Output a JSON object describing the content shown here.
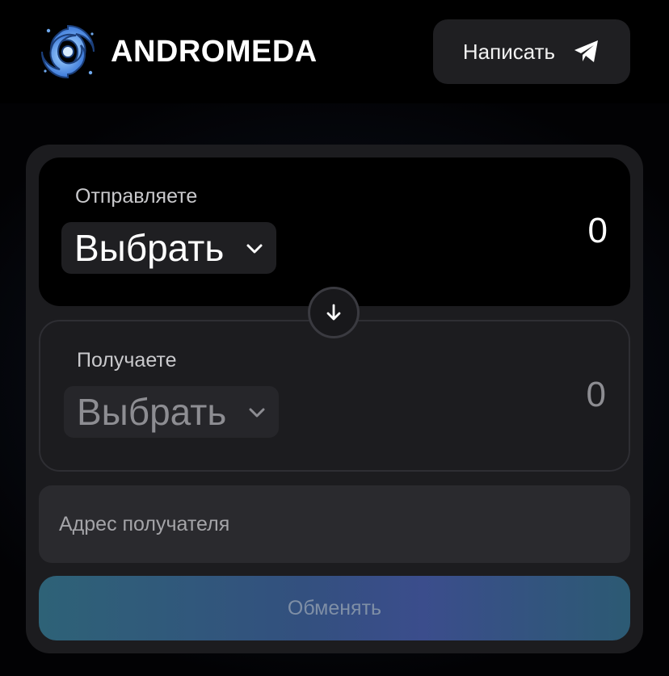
{
  "header": {
    "brand": "ANDROMEDA",
    "logo_icon": "galaxy-logo-icon",
    "write_button": {
      "label": "Написать",
      "icon": "telegram-icon"
    }
  },
  "swap": {
    "send": {
      "label": "Отправляете",
      "token_select": "Выбрать",
      "amount": "0"
    },
    "direction_icon": "arrow-down-icon",
    "receive": {
      "label": "Получаете",
      "token_select": "Выбрать",
      "amount": "0"
    },
    "recipient_address": {
      "value": "",
      "placeholder": "Адрес получателя"
    },
    "exchange_button": "Обменять"
  },
  "colors": {
    "background": "#000000",
    "card": "#1c1c1f",
    "send_panel": "#000000",
    "input": "#2a2a2e",
    "button_gradient_start": "#2e6277",
    "button_gradient_mid": "#3b4d8c"
  }
}
